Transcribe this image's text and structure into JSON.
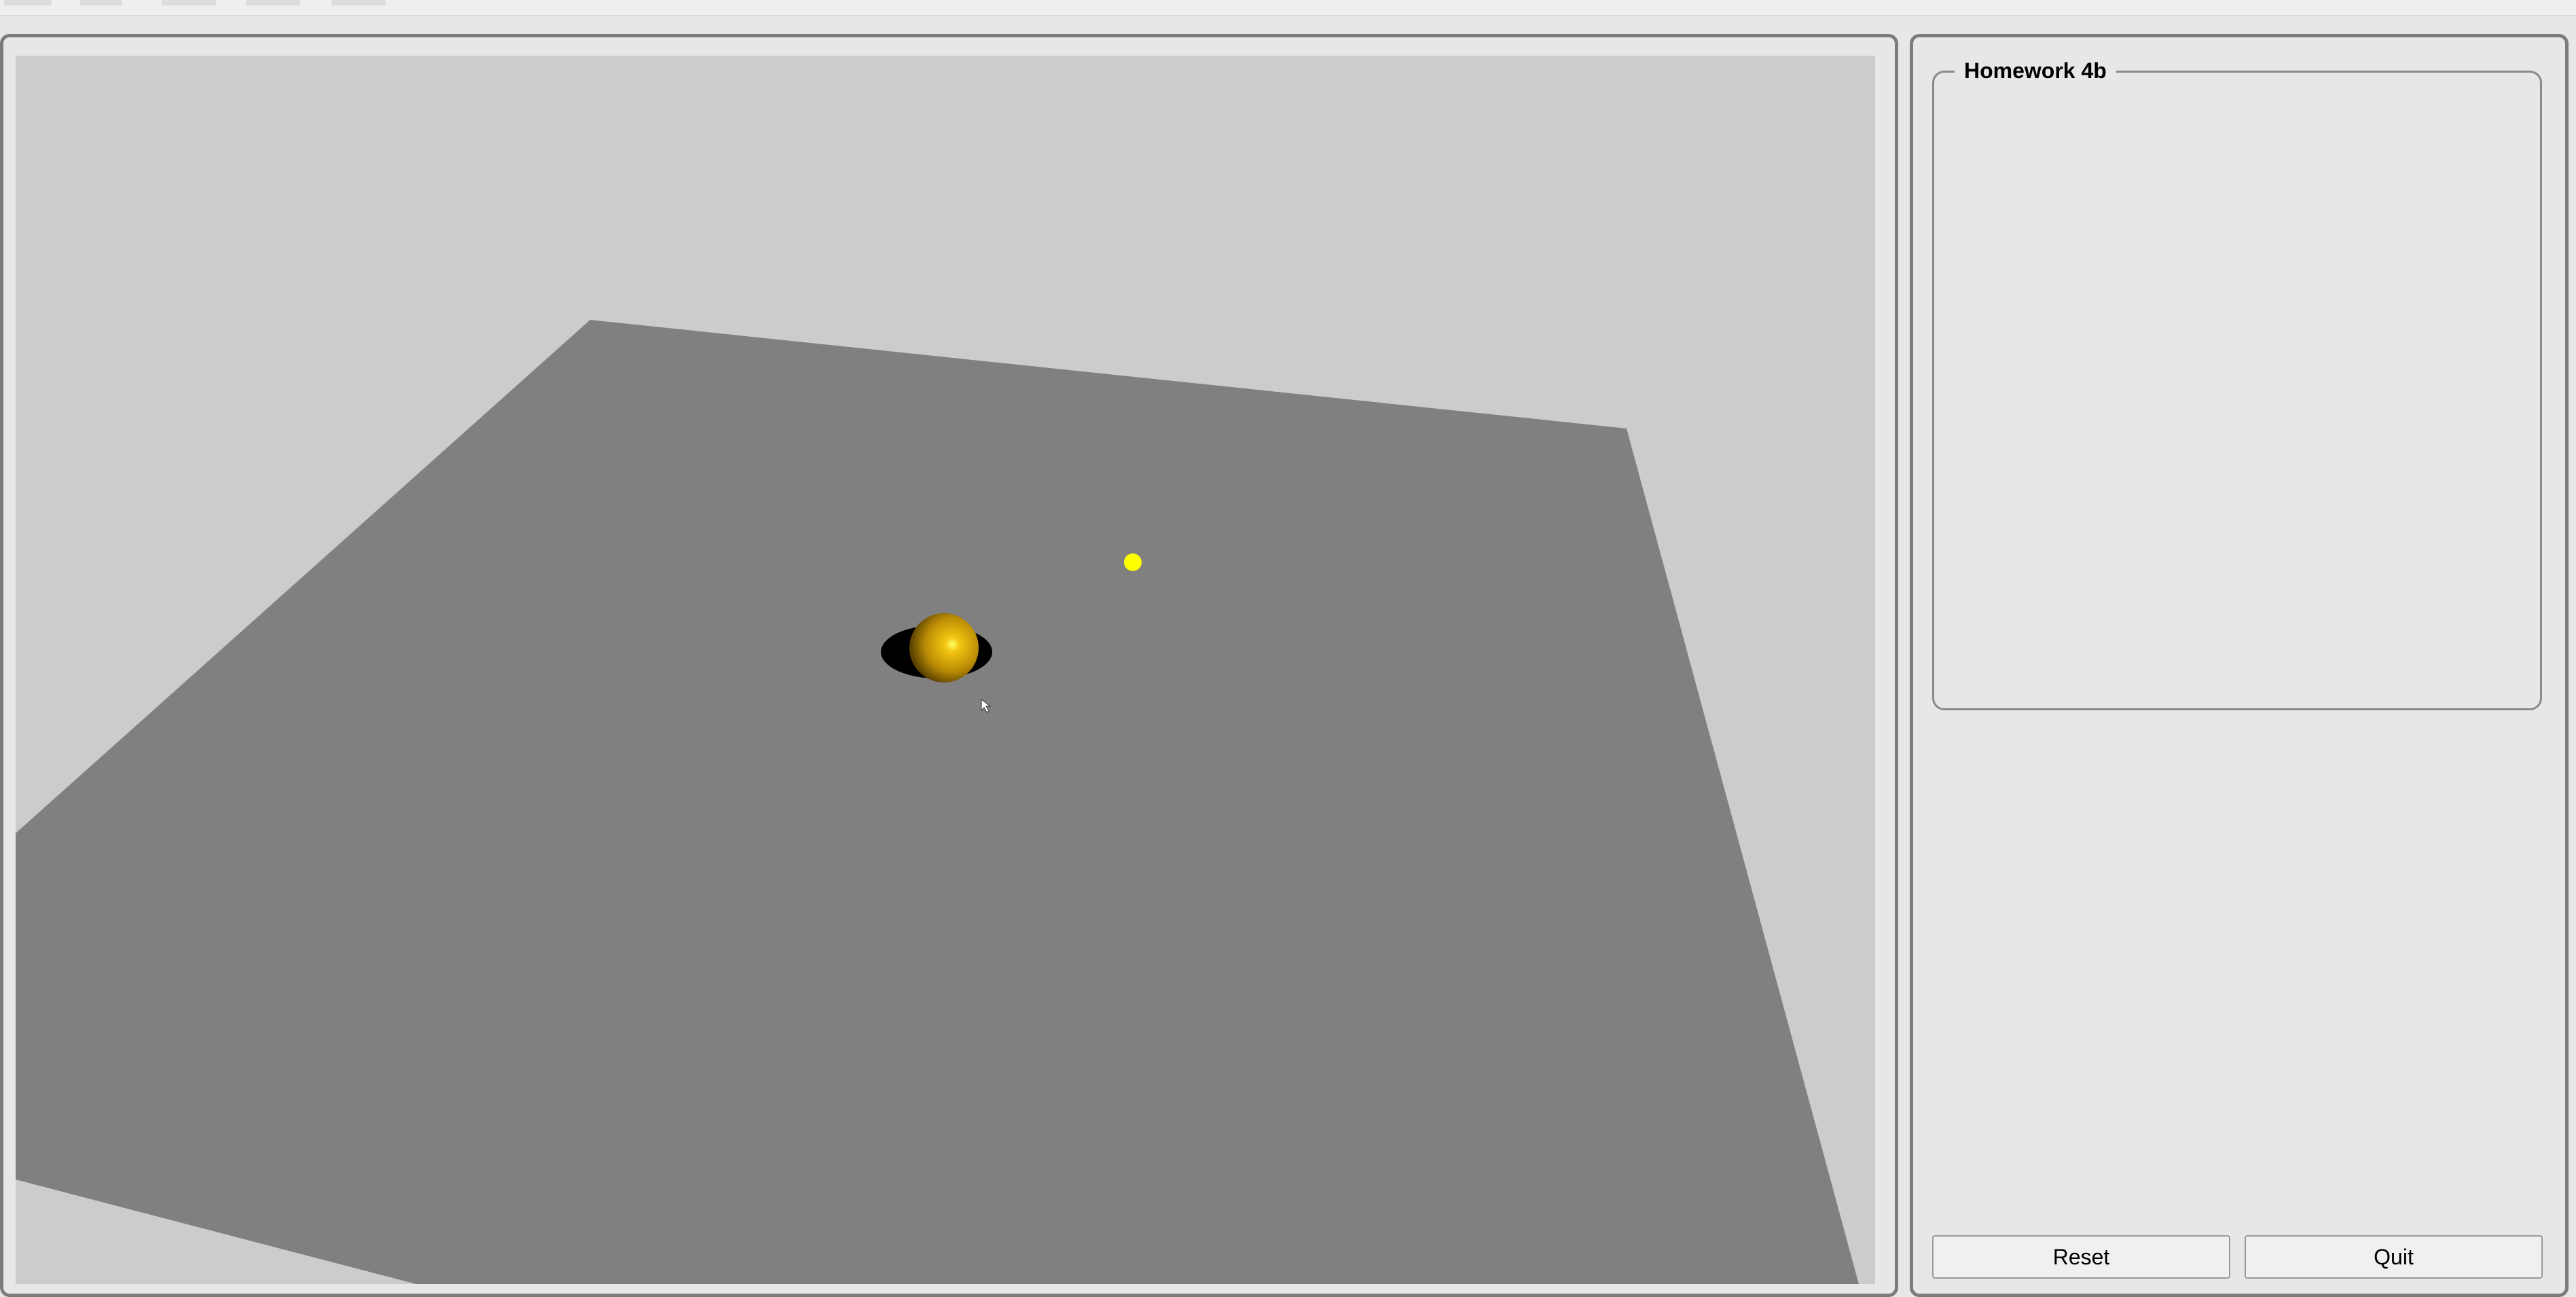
{
  "panel": {
    "title": "Homework 4b"
  },
  "buttons": {
    "reset_label": "Reset",
    "quit_label": "Quit"
  },
  "scene": {
    "background_color": "#cccccc",
    "floor_color": "#808080",
    "sphere_color": "#c99a06",
    "light_color": "#ffff00",
    "shadow_color": "#000000"
  }
}
